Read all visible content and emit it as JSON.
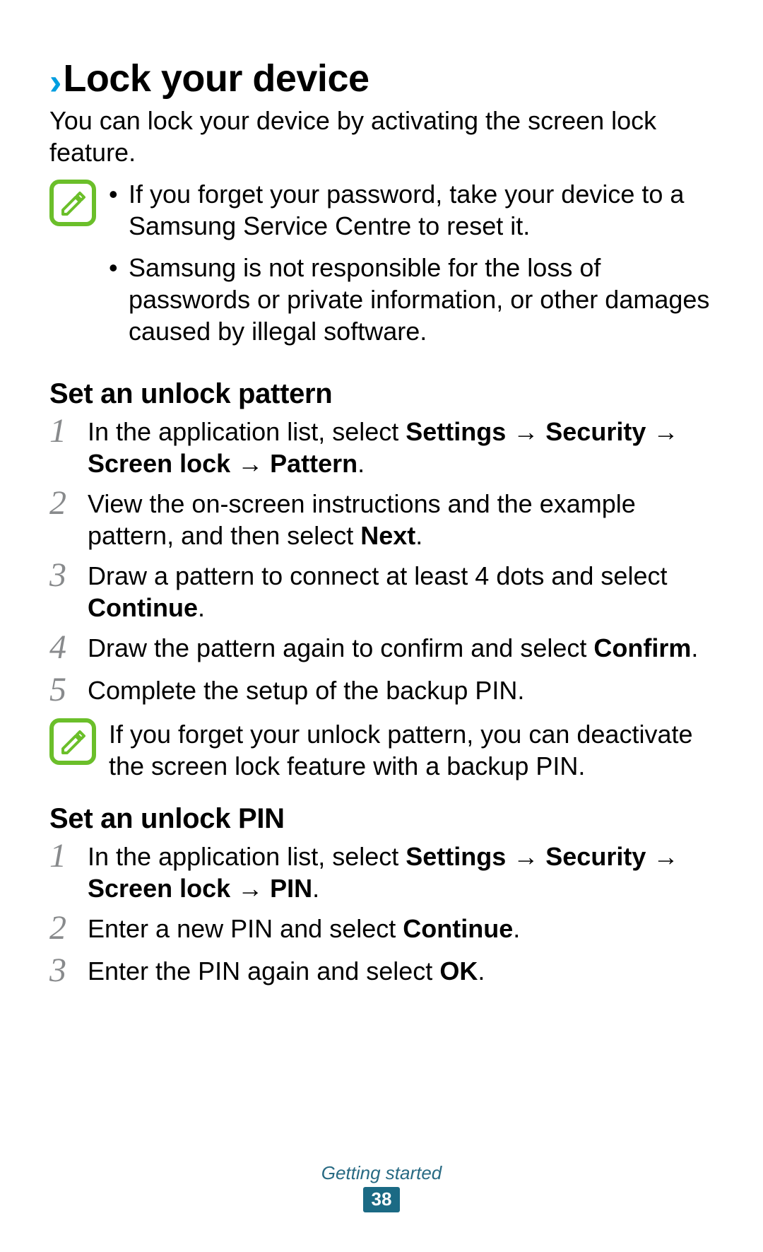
{
  "title": {
    "chevron": "›",
    "text": "Lock your device"
  },
  "intro": "You can lock your device by activating the screen lock feature.",
  "note1_bullets": [
    "If you forget your password, take your device to a Samsung Service Centre to reset it.",
    "Samsung is not responsible for the loss of passwords or private information, or other damages caused by illegal software."
  ],
  "pattern": {
    "heading": "Set an unlock pattern",
    "steps": {
      "s1_num": "1",
      "s1_pre": "In the application list, select ",
      "s1_bold": "Settings → Security → Screen lock → Pattern",
      "s1_post": ".",
      "s2_num": "2",
      "s2_pre": "View the on-screen instructions and the example pattern, and then select ",
      "s2_bold": "Next",
      "s2_post": ".",
      "s3_num": "3",
      "s3_pre": "Draw a pattern to connect at least 4 dots and select ",
      "s3_bold": "Continue",
      "s3_post": ".",
      "s4_num": "4",
      "s4_pre": "Draw the pattern again to confirm and select ",
      "s4_bold": "Confirm",
      "s4_post": ".",
      "s5_num": "5",
      "s5_text": "Complete the setup of the backup PIN."
    },
    "note": "If you forget your unlock pattern, you can deactivate the screen lock feature with a backup PIN."
  },
  "pin": {
    "heading": "Set an unlock PIN",
    "steps": {
      "s1_num": "1",
      "s1_pre": "In the application list, select ",
      "s1_bold": "Settings → Security → Screen lock → PIN",
      "s1_post": ".",
      "s2_num": "2",
      "s2_pre": "Enter a new PIN and select ",
      "s2_bold": "Continue",
      "s2_post": ".",
      "s3_num": "3",
      "s3_pre": "Enter the PIN again and select ",
      "s3_bold": "OK",
      "s3_post": "."
    }
  },
  "footer": {
    "section": "Getting started",
    "page": "38"
  }
}
